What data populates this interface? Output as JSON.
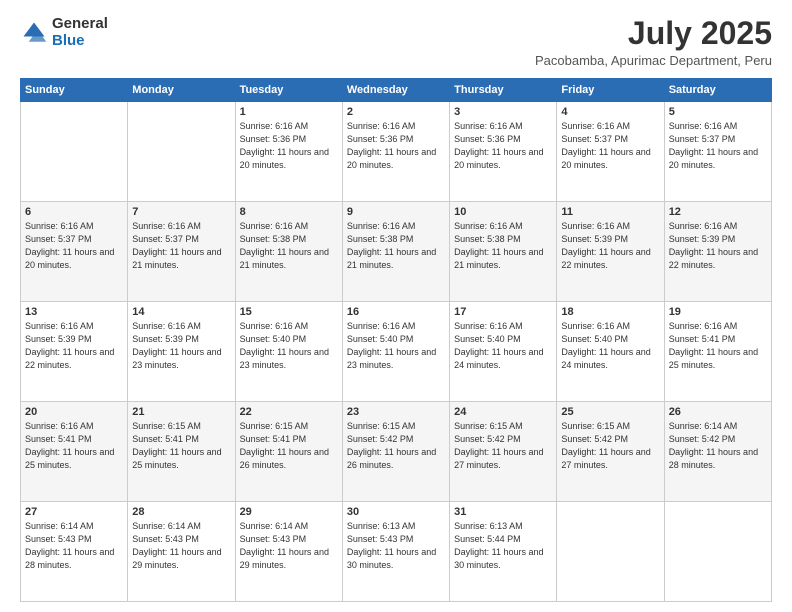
{
  "logo": {
    "general": "General",
    "blue": "Blue"
  },
  "header": {
    "month_year": "July 2025",
    "location": "Pacobamba, Apurimac Department, Peru"
  },
  "days_of_week": [
    "Sunday",
    "Monday",
    "Tuesday",
    "Wednesday",
    "Thursday",
    "Friday",
    "Saturday"
  ],
  "weeks": [
    [
      {
        "day": "",
        "info": ""
      },
      {
        "day": "",
        "info": ""
      },
      {
        "day": "1",
        "info": "Sunrise: 6:16 AM\nSunset: 5:36 PM\nDaylight: 11 hours and 20 minutes."
      },
      {
        "day": "2",
        "info": "Sunrise: 6:16 AM\nSunset: 5:36 PM\nDaylight: 11 hours and 20 minutes."
      },
      {
        "day": "3",
        "info": "Sunrise: 6:16 AM\nSunset: 5:36 PM\nDaylight: 11 hours and 20 minutes."
      },
      {
        "day": "4",
        "info": "Sunrise: 6:16 AM\nSunset: 5:37 PM\nDaylight: 11 hours and 20 minutes."
      },
      {
        "day": "5",
        "info": "Sunrise: 6:16 AM\nSunset: 5:37 PM\nDaylight: 11 hours and 20 minutes."
      }
    ],
    [
      {
        "day": "6",
        "info": "Sunrise: 6:16 AM\nSunset: 5:37 PM\nDaylight: 11 hours and 20 minutes."
      },
      {
        "day": "7",
        "info": "Sunrise: 6:16 AM\nSunset: 5:37 PM\nDaylight: 11 hours and 21 minutes."
      },
      {
        "day": "8",
        "info": "Sunrise: 6:16 AM\nSunset: 5:38 PM\nDaylight: 11 hours and 21 minutes."
      },
      {
        "day": "9",
        "info": "Sunrise: 6:16 AM\nSunset: 5:38 PM\nDaylight: 11 hours and 21 minutes."
      },
      {
        "day": "10",
        "info": "Sunrise: 6:16 AM\nSunset: 5:38 PM\nDaylight: 11 hours and 21 minutes."
      },
      {
        "day": "11",
        "info": "Sunrise: 6:16 AM\nSunset: 5:39 PM\nDaylight: 11 hours and 22 minutes."
      },
      {
        "day": "12",
        "info": "Sunrise: 6:16 AM\nSunset: 5:39 PM\nDaylight: 11 hours and 22 minutes."
      }
    ],
    [
      {
        "day": "13",
        "info": "Sunrise: 6:16 AM\nSunset: 5:39 PM\nDaylight: 11 hours and 22 minutes."
      },
      {
        "day": "14",
        "info": "Sunrise: 6:16 AM\nSunset: 5:39 PM\nDaylight: 11 hours and 23 minutes."
      },
      {
        "day": "15",
        "info": "Sunrise: 6:16 AM\nSunset: 5:40 PM\nDaylight: 11 hours and 23 minutes."
      },
      {
        "day": "16",
        "info": "Sunrise: 6:16 AM\nSunset: 5:40 PM\nDaylight: 11 hours and 23 minutes."
      },
      {
        "day": "17",
        "info": "Sunrise: 6:16 AM\nSunset: 5:40 PM\nDaylight: 11 hours and 24 minutes."
      },
      {
        "day": "18",
        "info": "Sunrise: 6:16 AM\nSunset: 5:40 PM\nDaylight: 11 hours and 24 minutes."
      },
      {
        "day": "19",
        "info": "Sunrise: 6:16 AM\nSunset: 5:41 PM\nDaylight: 11 hours and 25 minutes."
      }
    ],
    [
      {
        "day": "20",
        "info": "Sunrise: 6:16 AM\nSunset: 5:41 PM\nDaylight: 11 hours and 25 minutes."
      },
      {
        "day": "21",
        "info": "Sunrise: 6:15 AM\nSunset: 5:41 PM\nDaylight: 11 hours and 25 minutes."
      },
      {
        "day": "22",
        "info": "Sunrise: 6:15 AM\nSunset: 5:41 PM\nDaylight: 11 hours and 26 minutes."
      },
      {
        "day": "23",
        "info": "Sunrise: 6:15 AM\nSunset: 5:42 PM\nDaylight: 11 hours and 26 minutes."
      },
      {
        "day": "24",
        "info": "Sunrise: 6:15 AM\nSunset: 5:42 PM\nDaylight: 11 hours and 27 minutes."
      },
      {
        "day": "25",
        "info": "Sunrise: 6:15 AM\nSunset: 5:42 PM\nDaylight: 11 hours and 27 minutes."
      },
      {
        "day": "26",
        "info": "Sunrise: 6:14 AM\nSunset: 5:42 PM\nDaylight: 11 hours and 28 minutes."
      }
    ],
    [
      {
        "day": "27",
        "info": "Sunrise: 6:14 AM\nSunset: 5:43 PM\nDaylight: 11 hours and 28 minutes."
      },
      {
        "day": "28",
        "info": "Sunrise: 6:14 AM\nSunset: 5:43 PM\nDaylight: 11 hours and 29 minutes."
      },
      {
        "day": "29",
        "info": "Sunrise: 6:14 AM\nSunset: 5:43 PM\nDaylight: 11 hours and 29 minutes."
      },
      {
        "day": "30",
        "info": "Sunrise: 6:13 AM\nSunset: 5:43 PM\nDaylight: 11 hours and 30 minutes."
      },
      {
        "day": "31",
        "info": "Sunrise: 6:13 AM\nSunset: 5:44 PM\nDaylight: 11 hours and 30 minutes."
      },
      {
        "day": "",
        "info": ""
      },
      {
        "day": "",
        "info": ""
      }
    ]
  ]
}
